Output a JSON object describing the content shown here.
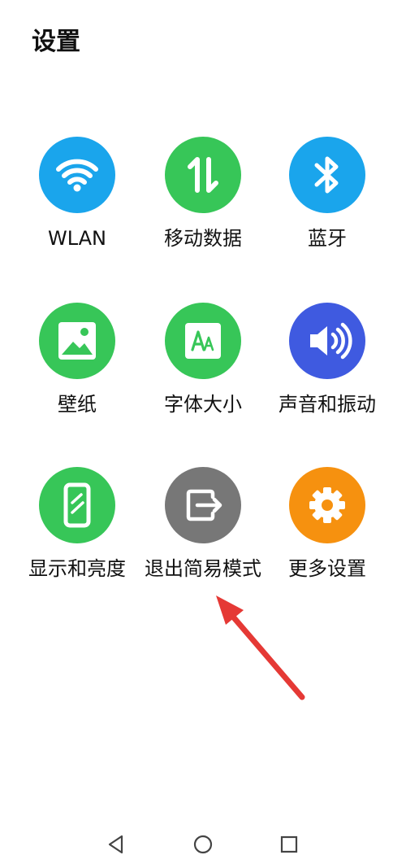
{
  "header": {
    "title": "设置"
  },
  "tiles": [
    {
      "label": "WLAN",
      "icon": "wifi-icon",
      "color": "#1aa5ec"
    },
    {
      "label": "移动数据",
      "icon": "data-transfer-icon",
      "color": "#37c658"
    },
    {
      "label": "蓝牙",
      "icon": "bluetooth-icon",
      "color": "#1aa5ec"
    },
    {
      "label": "壁纸",
      "icon": "wallpaper-icon",
      "color": "#37c658"
    },
    {
      "label": "字体大小",
      "icon": "font-size-icon",
      "color": "#37c658"
    },
    {
      "label": "声音和振动",
      "icon": "speaker-icon",
      "color": "#3f5ae0"
    },
    {
      "label": "显示和亮度",
      "icon": "display-phone-icon",
      "color": "#37c658"
    },
    {
      "label": "退出简易模式",
      "icon": "exit-icon",
      "color": "#777777"
    },
    {
      "label": "更多设置",
      "icon": "gear-icon",
      "color": "#f6910f"
    }
  ],
  "annotation": {
    "arrow_color": "#e53935"
  },
  "navbar": {
    "back": "back-triangle-icon",
    "home": "home-circle-icon",
    "recents": "recents-square-icon"
  }
}
